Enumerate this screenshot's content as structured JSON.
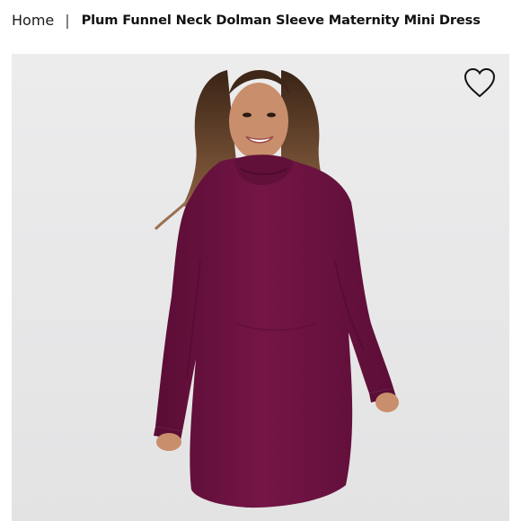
{
  "breadcrumb": {
    "home_label": "Home",
    "separator": "|",
    "current_label": "Plum Funnel Neck Dolman Sleeve Maternity Mini Dress"
  },
  "product_image": {
    "wishlist_icon": "heart-outline-icon",
    "dress_color": "#6b1140"
  }
}
